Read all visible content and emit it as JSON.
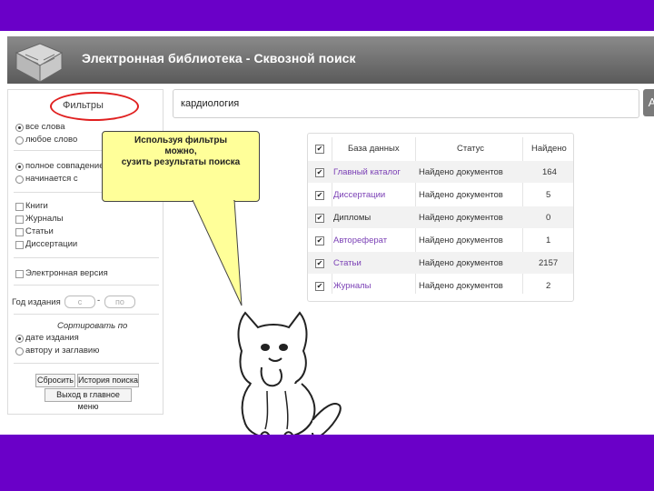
{
  "header": {
    "title": "Электронная библиотека - Сквозной поиск",
    "logo_icon": "open-book-icon"
  },
  "sidebar": {
    "tab_label": "Фильтры",
    "word_mode": [
      {
        "label": "все слова",
        "selected": true
      },
      {
        "label": "любое слово",
        "selected": false
      }
    ],
    "match_mode": [
      {
        "label": "полное совпадение",
        "selected": true
      },
      {
        "label": "начинается с",
        "selected": false
      }
    ],
    "types": [
      "Книги",
      "Журналы",
      "Статьи",
      "Диссертации"
    ],
    "electronic": "Электронная версия",
    "year_label": "Год издания",
    "year_from": "с",
    "year_to": "по",
    "sort_title": "Сортировать по",
    "sort_options": [
      {
        "label": "дате издания",
        "selected": true
      },
      {
        "label": "автору и заглавию",
        "selected": false
      }
    ],
    "reset_button": "Сбросить",
    "history_button": "История поиска",
    "main_menu_button": "Выход в главное меню"
  },
  "search": {
    "value": "кардиология",
    "button_glyph": "А"
  },
  "results": {
    "headers": [
      "База данных",
      "Статус",
      "Найдено"
    ],
    "rows": [
      {
        "db": "Главный каталог",
        "status": "Найдено документов",
        "count": "164"
      },
      {
        "db": "Диссертации",
        "status": "Найдено документов",
        "count": "5"
      },
      {
        "db": "Дипломы",
        "status": "Найдено документов",
        "count": "0"
      },
      {
        "db": "Автореферат",
        "status": "Найдено документов",
        "count": "1"
      },
      {
        "db": "Статьи",
        "status": "Найдено документов",
        "count": "2157"
      },
      {
        "db": "Журналы",
        "status": "Найдено документов",
        "count": "2"
      }
    ]
  },
  "callout": {
    "line1": "Используя фильтры",
    "line2": "можно,",
    "line3": "сузить результаты поиска"
  },
  "colors": {
    "frame": "#6a00c8",
    "highlight_ellipse": "#e02020",
    "callout_bg": "#ffff99",
    "link": "#7a3fb5"
  }
}
